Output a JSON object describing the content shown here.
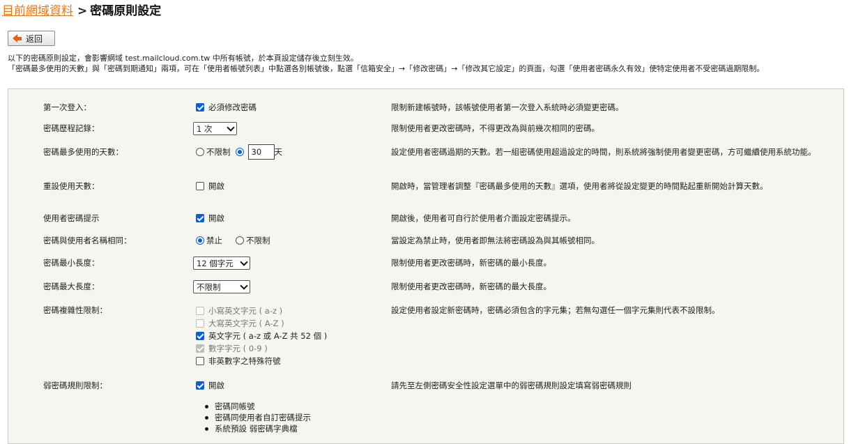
{
  "breadcrumb": {
    "link": "目前網域資料",
    "separator": ">",
    "current": "密碼原則設定"
  },
  "back_button": "返回",
  "intro": {
    "line1": "以下的密碼原則設定，會影響網域 test.mailcloud.com.tw 中所有帳號，於本頁設定儲存後立刻生效。",
    "line2": "「密碼最多使用的天數」與「密碼到期通知」兩項，可在「使用者帳號列表」中點選各別帳號後，點選「信箱安全」→「修改密碼」→「修改其它設定」的頁面，勾選「使用者密碼永久有效」使特定使用者不受密碼過期限制。"
  },
  "rows": {
    "first_login": {
      "label": "第一次登入：",
      "option": "必須修改密碼",
      "checked": true,
      "desc": "限制新建帳號時，該帳號使用者第一次登入系統時必須變更密碼。"
    },
    "history": {
      "label": "密碼歷程記錄：",
      "value": "1 次",
      "desc": "限制使用者更改密碼時，不得更改為與前幾次相同的密碼。"
    },
    "max_days": {
      "label": "密碼最多使用的天數：",
      "opt_unlimited": "不限制",
      "days_value": "30",
      "unit": "天",
      "desc": "設定使用者密碼過期的天數。若一組密碼使用超過設定的時間，則系統將強制使用者變更密碼，方可繼續使用系統功能。"
    },
    "reset_days": {
      "label": "重設使用天數：",
      "option": "開啟",
      "checked": false,
      "desc": "開啟時，當管理者調整『密碼最多使用的天數』選項，使用者將從設定變更的時間點起重新開始計算天數。"
    },
    "hint": {
      "label": "使用者密碼提示",
      "option": "開啟",
      "checked": true,
      "desc": "開啟後，使用者可自行於使用者介面設定密碼提示。"
    },
    "same_name": {
      "label": "密碼與使用者名稱相同：",
      "opt_forbid": "禁止",
      "opt_unlimited": "不限制",
      "selected": "禁止",
      "desc": "當設定為禁止時，使用者即無法將密碼設為與其帳號相同。"
    },
    "min_len": {
      "label": "密碼最小長度：",
      "value": "12 個字元",
      "desc": "限制使用者更改密碼時，新密碼的最小長度。"
    },
    "max_len": {
      "label": "密碼最大長度：",
      "value": "不限制",
      "desc": "限制使用者更改密碼時，新密碼的最大長度。"
    },
    "complexity": {
      "label": "密碼複雜性限制：",
      "options": [
        {
          "text": "小寫英文字元 ( a-z )",
          "state": "disabled"
        },
        {
          "text": "大寫英文字元 ( A-Z )",
          "state": "disabled"
        },
        {
          "text": "英文字元 ( a-z 或 A-Z 共 52 個 )",
          "state": "checked"
        },
        {
          "text": "數字字元 ( 0-9 )",
          "state": "disabled-checked"
        },
        {
          "text": "非英數字之特殊符號",
          "state": "unchecked"
        }
      ],
      "desc": "設定使用者設定新密碼時，密碼必須包含的字元集；若無勾選任一個字元集則代表不設限制。"
    },
    "weak": {
      "label": "弱密碼規則限制：",
      "option": "開啟",
      "checked": true,
      "desc": "請先至左側密碼安全性設定選單中的弱密碼規則設定填寫弱密碼規則",
      "rules": [
        "密碼同帳號",
        "密碼同使用者自訂密碼提示",
        "系統預設 弱密碼字典檔"
      ]
    }
  },
  "colors": {
    "accent": "#e07a1f",
    "checkbox": "#0b5fd6",
    "panel_bg": "#f6f6f1"
  }
}
